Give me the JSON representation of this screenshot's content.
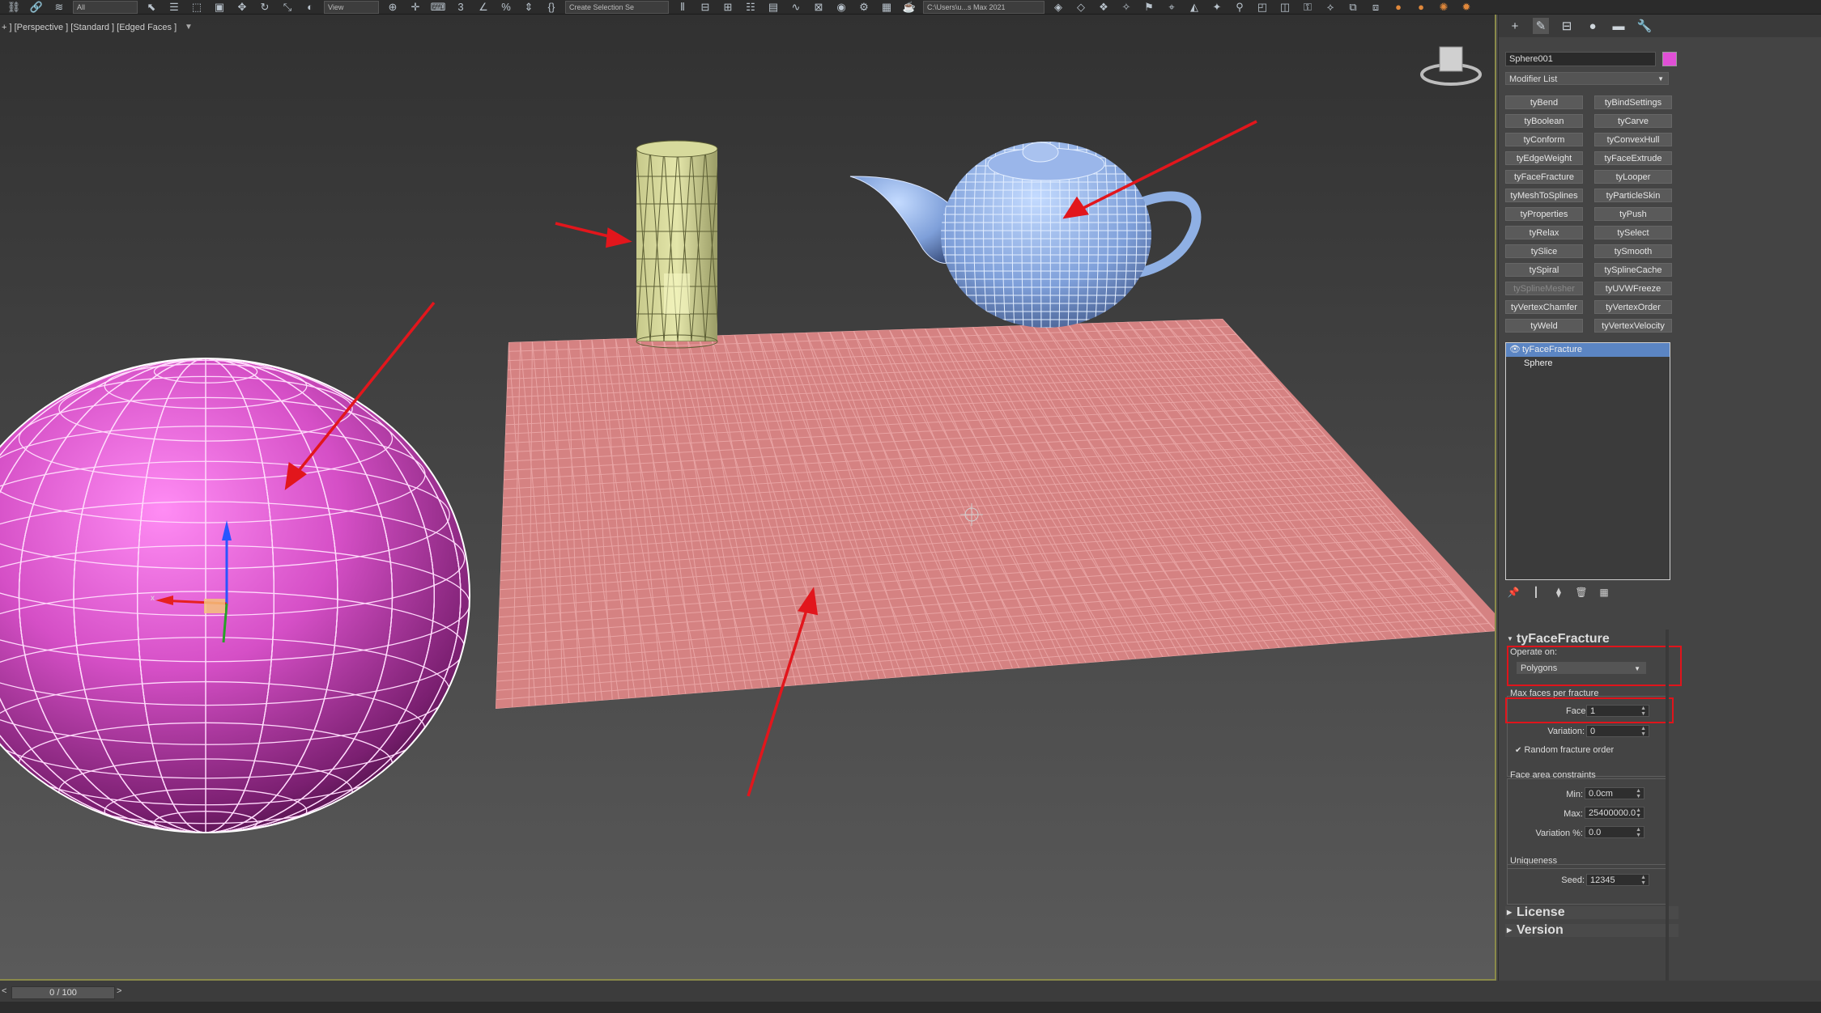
{
  "toolbar": {
    "filter_dropdown": "All",
    "view_dropdown": "View",
    "selection_set": "Create Selection Se",
    "project_path": "C:\\Users\\u...s Max 2021"
  },
  "viewport": {
    "label": "+ ] [Perspective ] [Standard ] [Edged Faces ]"
  },
  "panel": {
    "object_name": "Sphere001",
    "object_color": "#e04fd6",
    "modifier_list": "Modifier List",
    "modifier_buttons": [
      {
        "label": "tyBend",
        "enabled": true
      },
      {
        "label": "tyBindSettings",
        "enabled": true
      },
      {
        "label": "tyBoolean",
        "enabled": true
      },
      {
        "label": "tyCarve",
        "enabled": true
      },
      {
        "label": "tyConform",
        "enabled": true
      },
      {
        "label": "tyConvexHull",
        "enabled": true
      },
      {
        "label": "tyEdgeWeight",
        "enabled": true
      },
      {
        "label": "tyFaceExtrude",
        "enabled": true
      },
      {
        "label": "tyFaceFracture",
        "enabled": true
      },
      {
        "label": "tyLooper",
        "enabled": true
      },
      {
        "label": "tyMeshToSplines",
        "enabled": true
      },
      {
        "label": "tyParticleSkin",
        "enabled": true
      },
      {
        "label": "tyProperties",
        "enabled": true
      },
      {
        "label": "tyPush",
        "enabled": true
      },
      {
        "label": "tyRelax",
        "enabled": true
      },
      {
        "label": "tySelect",
        "enabled": true
      },
      {
        "label": "tySlice",
        "enabled": true
      },
      {
        "label": "tySmooth",
        "enabled": true
      },
      {
        "label": "tySpiral",
        "enabled": true
      },
      {
        "label": "tySplineCache",
        "enabled": true
      },
      {
        "label": "tySplineMesher",
        "enabled": false
      },
      {
        "label": "tyUVWFreeze",
        "enabled": true
      },
      {
        "label": "tyVertexChamfer",
        "enabled": true
      },
      {
        "label": "tyVertexOrder",
        "enabled": true
      },
      {
        "label": "tyWeld",
        "enabled": true
      },
      {
        "label": "tyVertexVelocity",
        "enabled": true
      }
    ],
    "stack": [
      "tyFaceFracture",
      "Sphere"
    ],
    "rollout": {
      "title": "tyFaceFracture",
      "operate_on_label": "Operate on:",
      "operate_on_value": "Polygons",
      "max_faces_label": "Max faces per fracture",
      "faces_label": "Faces:",
      "faces_value": "1",
      "variation_label": "Variation:",
      "variation_value": "0",
      "random_order_label": "Random fracture order",
      "random_order_checked": true,
      "area_label": "Face area constraints",
      "min_label": "Min:",
      "min_value": "0.0cm",
      "max_label": "Max:",
      "max_value": "25400000.0",
      "area_variation_label": "Variation  %:",
      "area_variation_value": "0.0",
      "uniqueness_label": "Uniqueness",
      "seed_label": "Seed:",
      "seed_value": "12345"
    },
    "collapsed_rollouts": [
      "License",
      "Version"
    ]
  },
  "timeline": {
    "frame": "0 / 100"
  }
}
